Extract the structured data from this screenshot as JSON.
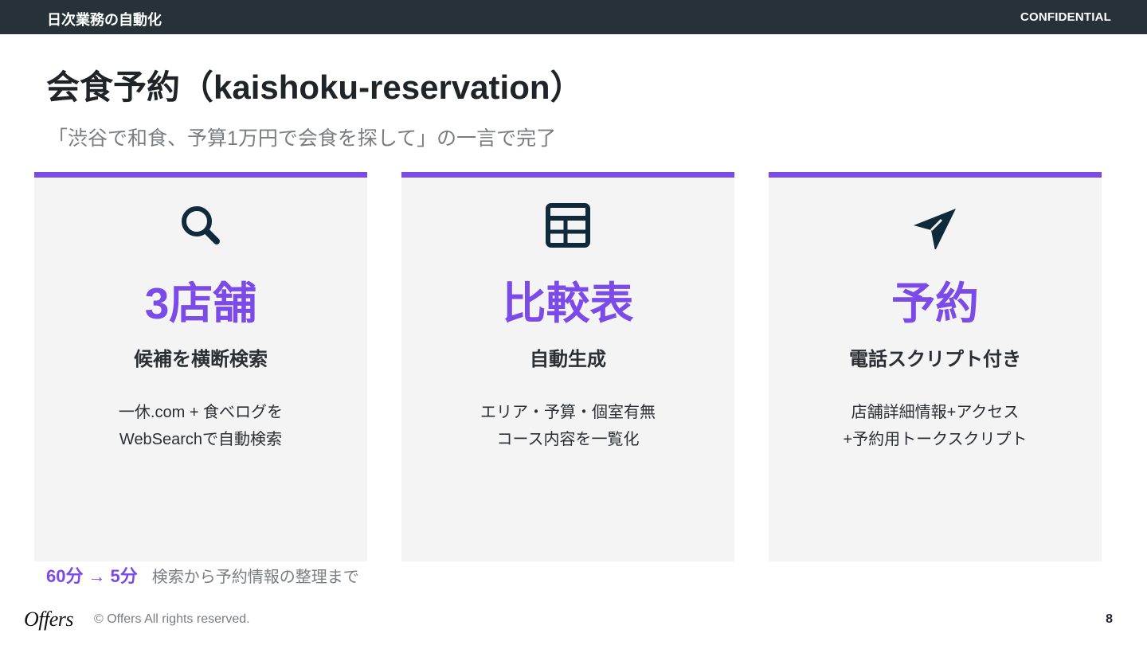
{
  "header": {
    "section": "日次業務の自動化",
    "confidential": "CONFIDENTIAL"
  },
  "slide": {
    "title": "会食予約（kaishoku-reservation）",
    "subtitle": "「渋谷で和食、予算1万円で会食を探して」の一言で完了"
  },
  "cards": [
    {
      "icon": "search-icon",
      "headline": "3店舗",
      "subhead": "候補を横断検索",
      "desc": [
        "一休.com + 食べログを",
        "WebSearchで自動検索"
      ]
    },
    {
      "icon": "table-icon",
      "headline": "比較表",
      "subhead": "自動生成",
      "desc": [
        "エリア・予算・個室有無",
        "コース内容を一覧化"
      ]
    },
    {
      "icon": "send-icon",
      "headline": "予約",
      "subhead": "電話スクリプト付き",
      "desc": [
        "店舗詳細情報+アクセス",
        "+予約用トークスクリプト"
      ]
    }
  ],
  "stat": {
    "before": "60分",
    "arrow": "→",
    "after": "5分",
    "note": "検索から予約情報の整理まで"
  },
  "footer": {
    "logo": "Offers",
    "copyright": "© Offers All rights reserved.",
    "page": "8"
  },
  "colors": {
    "accent": "#7b4ae8",
    "topbar": "#263238",
    "card_bg": "#f4f4f5",
    "icon": "#0f2a3a"
  }
}
